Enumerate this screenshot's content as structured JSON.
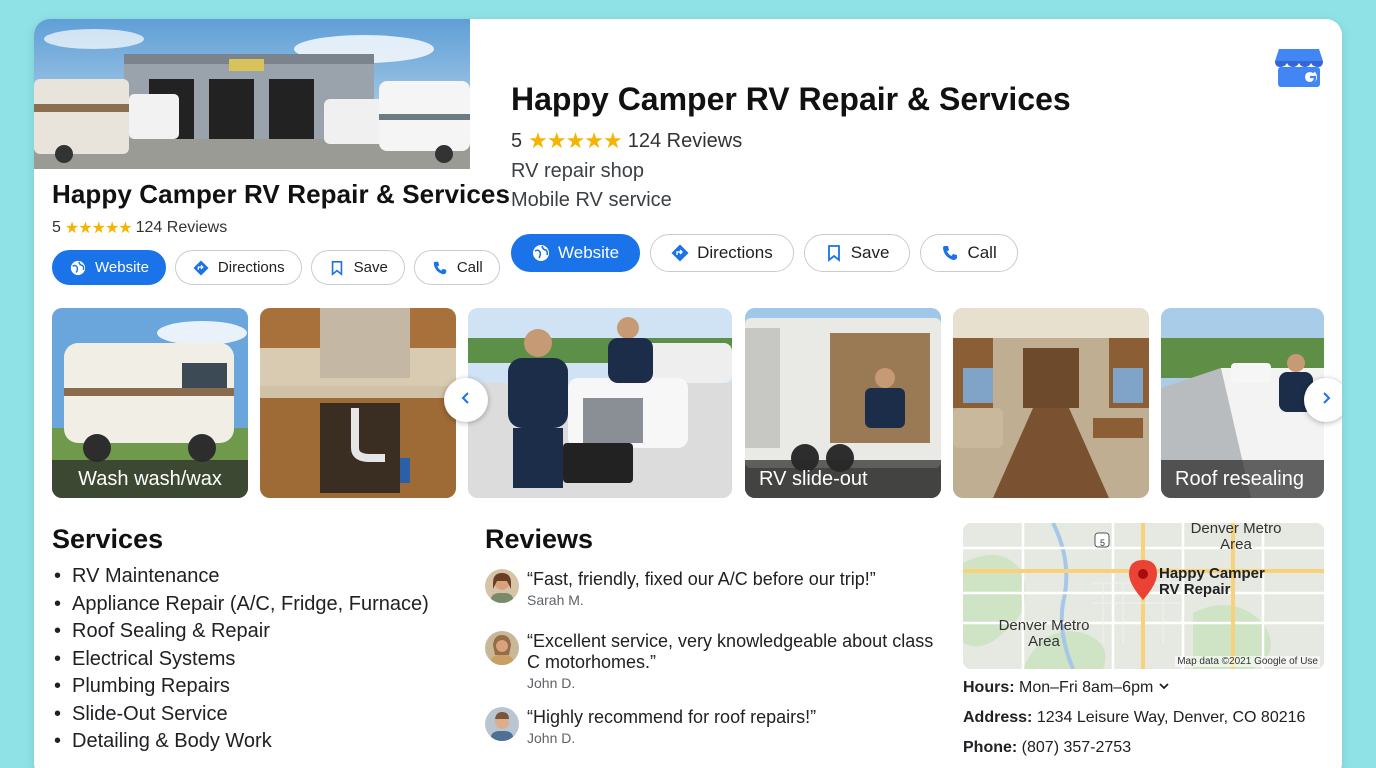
{
  "business": {
    "name": "Happy Camper RV Repair & Services",
    "rating": "5",
    "stars": "★★★★★",
    "reviews_count": "124 Reviews",
    "categories": [
      "RV repair shop",
      "Mobile RV service"
    ]
  },
  "actions": {
    "website": "Website",
    "directions": "Directions",
    "save": "Save",
    "call": "Call"
  },
  "photos": [
    {
      "caption": "Wash wash/wax"
    },
    {
      "caption": ""
    },
    {
      "caption": ""
    },
    {
      "caption": "RV slide-out"
    },
    {
      "caption": ""
    },
    {
      "caption": "Roof resealing"
    }
  ],
  "services": {
    "title": "Services",
    "items": [
      "RV Maintenance",
      "Appliance Repair (A/C, Fridge, Furnace)",
      "Roof Sealing & Repair",
      "Electrical Systems",
      "Plumbing Repairs",
      "Slide-Out Service",
      "Detailing & Body Work"
    ]
  },
  "reviews": {
    "title": "Reviews",
    "items": [
      {
        "quote": "“Fast, friendly, fixed our A/C before our trip!”",
        "author": "Sarah M."
      },
      {
        "quote": "“Excellent service, very knowledgeable about class C motorhomes.”",
        "author": "John D."
      },
      {
        "quote": "“Highly recommend for roof repairs!”",
        "author": "John D."
      }
    ]
  },
  "map": {
    "label_top": "Denver Metro Area",
    "label_bottom": "Denver Metro Area",
    "pin_label": "Happy Camper RV Repair",
    "road_shield": "5",
    "credit": "Map data ©2021 Google of Use"
  },
  "info": {
    "hours_label": "Hours:",
    "hours_value": "Mon–Fri 8am–6pm",
    "address_label": "Address:",
    "address_value": "1234 Leisure Way, Denver, CO 80216",
    "phone_label": "Phone:",
    "phone_value": "(807) 357-2753"
  },
  "colors": {
    "background": "#8fe3e6",
    "accent": "#1a73e8",
    "star": "#f4b400",
    "pin": "#ea4335"
  },
  "icons": [
    "globe-icon",
    "directions-icon",
    "bookmark-icon",
    "phone-icon",
    "google-business-icon",
    "chevron-left-icon",
    "chevron-right-icon",
    "chevron-down-icon",
    "map-pin-icon"
  ]
}
